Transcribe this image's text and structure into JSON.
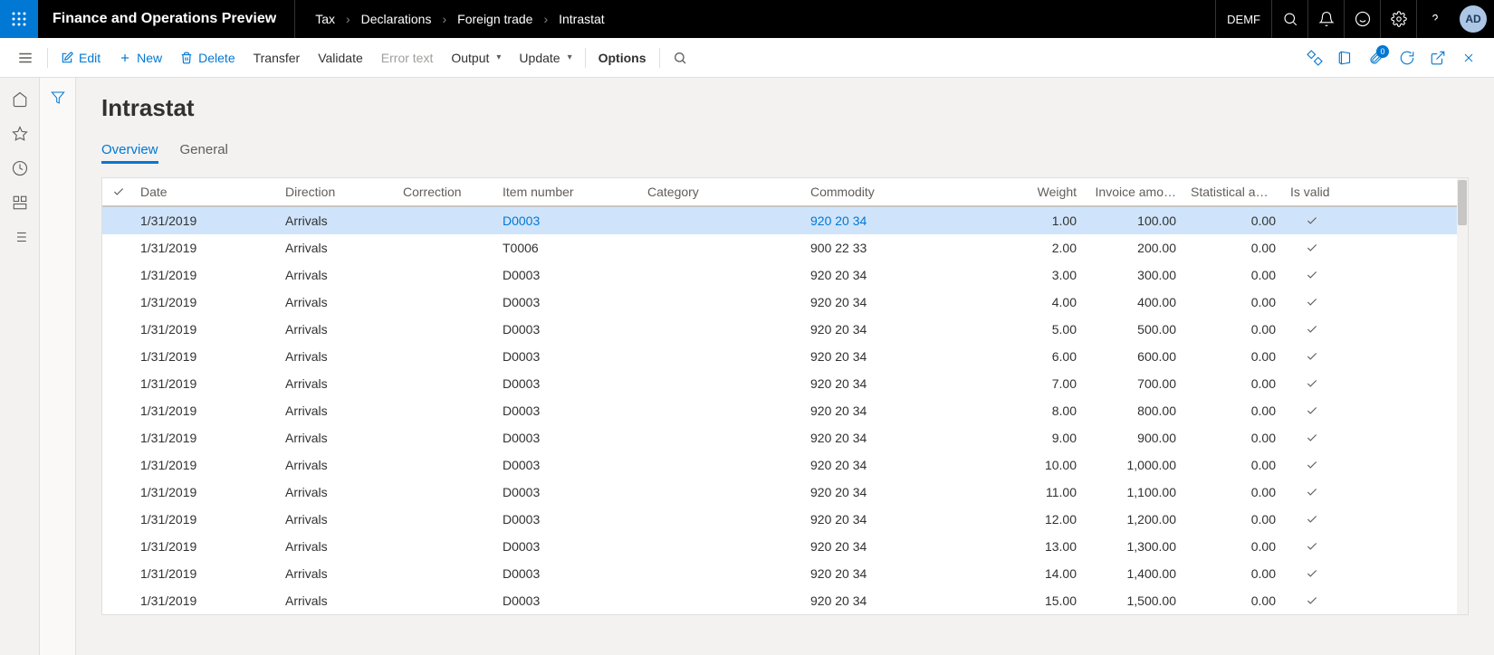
{
  "header": {
    "app_title": "Finance and Operations Preview",
    "breadcrumb": [
      "Tax",
      "Declarations",
      "Foreign trade",
      "Intrastat"
    ],
    "company": "DEMF",
    "avatar": "AD"
  },
  "commands": {
    "edit": "Edit",
    "new": "New",
    "delete": "Delete",
    "transfer": "Transfer",
    "validate": "Validate",
    "error_text": "Error text",
    "output": "Output",
    "update": "Update",
    "options": "Options",
    "attach_count": "0"
  },
  "page": {
    "title": "Intrastat",
    "tabs": {
      "overview": "Overview",
      "general": "General"
    }
  },
  "grid": {
    "columns": {
      "date": "Date",
      "direction": "Direction",
      "correction": "Correction",
      "item": "Item number",
      "category": "Category",
      "commodity": "Commodity",
      "weight": "Weight",
      "invoice": "Invoice amo…",
      "statistical": "Statistical am…",
      "valid": "Is valid"
    },
    "rows": [
      {
        "date": "1/31/2019",
        "direction": "Arrivals",
        "correction": "",
        "item": "D0003",
        "category": "",
        "commodity": "920 20 34",
        "weight": "1.00",
        "invoice": "100.00",
        "statistical": "0.00",
        "valid": true,
        "selected": true
      },
      {
        "date": "1/31/2019",
        "direction": "Arrivals",
        "correction": "",
        "item": "T0006",
        "category": "",
        "commodity": "900 22 33",
        "weight": "2.00",
        "invoice": "200.00",
        "statistical": "0.00",
        "valid": true
      },
      {
        "date": "1/31/2019",
        "direction": "Arrivals",
        "correction": "",
        "item": "D0003",
        "category": "",
        "commodity": "920 20 34",
        "weight": "3.00",
        "invoice": "300.00",
        "statistical": "0.00",
        "valid": true
      },
      {
        "date": "1/31/2019",
        "direction": "Arrivals",
        "correction": "",
        "item": "D0003",
        "category": "",
        "commodity": "920 20 34",
        "weight": "4.00",
        "invoice": "400.00",
        "statistical": "0.00",
        "valid": true
      },
      {
        "date": "1/31/2019",
        "direction": "Arrivals",
        "correction": "",
        "item": "D0003",
        "category": "",
        "commodity": "920 20 34",
        "weight": "5.00",
        "invoice": "500.00",
        "statistical": "0.00",
        "valid": true
      },
      {
        "date": "1/31/2019",
        "direction": "Arrivals",
        "correction": "",
        "item": "D0003",
        "category": "",
        "commodity": "920 20 34",
        "weight": "6.00",
        "invoice": "600.00",
        "statistical": "0.00",
        "valid": true
      },
      {
        "date": "1/31/2019",
        "direction": "Arrivals",
        "correction": "",
        "item": "D0003",
        "category": "",
        "commodity": "920 20 34",
        "weight": "7.00",
        "invoice": "700.00",
        "statistical": "0.00",
        "valid": true
      },
      {
        "date": "1/31/2019",
        "direction": "Arrivals",
        "correction": "",
        "item": "D0003",
        "category": "",
        "commodity": "920 20 34",
        "weight": "8.00",
        "invoice": "800.00",
        "statistical": "0.00",
        "valid": true
      },
      {
        "date": "1/31/2019",
        "direction": "Arrivals",
        "correction": "",
        "item": "D0003",
        "category": "",
        "commodity": "920 20 34",
        "weight": "9.00",
        "invoice": "900.00",
        "statistical": "0.00",
        "valid": true
      },
      {
        "date": "1/31/2019",
        "direction": "Arrivals",
        "correction": "",
        "item": "D0003",
        "category": "",
        "commodity": "920 20 34",
        "weight": "10.00",
        "invoice": "1,000.00",
        "statistical": "0.00",
        "valid": true
      },
      {
        "date": "1/31/2019",
        "direction": "Arrivals",
        "correction": "",
        "item": "D0003",
        "category": "",
        "commodity": "920 20 34",
        "weight": "11.00",
        "invoice": "1,100.00",
        "statistical": "0.00",
        "valid": true
      },
      {
        "date": "1/31/2019",
        "direction": "Arrivals",
        "correction": "",
        "item": "D0003",
        "category": "",
        "commodity": "920 20 34",
        "weight": "12.00",
        "invoice": "1,200.00",
        "statistical": "0.00",
        "valid": true
      },
      {
        "date": "1/31/2019",
        "direction": "Arrivals",
        "correction": "",
        "item": "D0003",
        "category": "",
        "commodity": "920 20 34",
        "weight": "13.00",
        "invoice": "1,300.00",
        "statistical": "0.00",
        "valid": true
      },
      {
        "date": "1/31/2019",
        "direction": "Arrivals",
        "correction": "",
        "item": "D0003",
        "category": "",
        "commodity": "920 20 34",
        "weight": "14.00",
        "invoice": "1,400.00",
        "statistical": "0.00",
        "valid": true
      },
      {
        "date": "1/31/2019",
        "direction": "Arrivals",
        "correction": "",
        "item": "D0003",
        "category": "",
        "commodity": "920 20 34",
        "weight": "15.00",
        "invoice": "1,500.00",
        "statistical": "0.00",
        "valid": true
      }
    ]
  }
}
